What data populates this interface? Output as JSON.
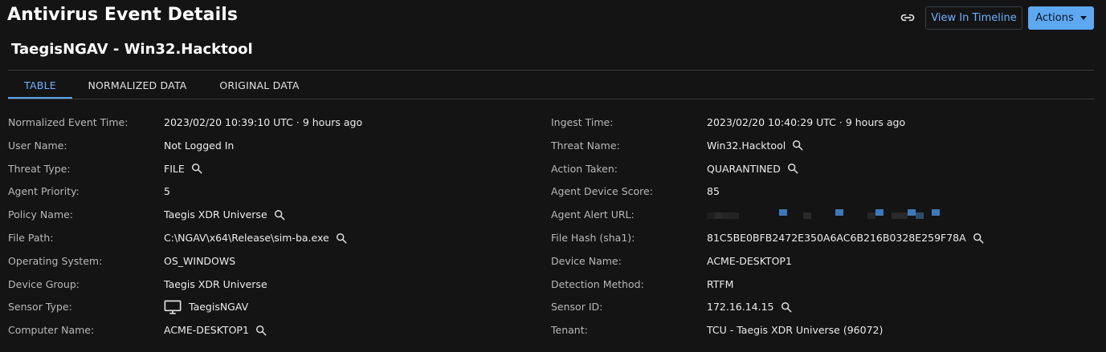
{
  "header": {
    "page_title": "Antivirus Event Details",
    "link_icon": "link-icon",
    "view_timeline_label": "View In Timeline",
    "actions_label": "Actions"
  },
  "event_title": "TaegisNGAV - Win32.Hacktool",
  "tabs": [
    {
      "label": "TABLE",
      "active": true
    },
    {
      "label": "NORMALIZED DATA",
      "active": false
    },
    {
      "label": "ORIGINAL DATA",
      "active": false
    }
  ],
  "colors": {
    "background": "#141414",
    "accent": "#5ea8f2",
    "link_text": "#6fb1ff",
    "label_text": "#b8b8b8",
    "value_text": "#ececec",
    "redacted_block": "#3d79b8"
  },
  "left_fields": [
    {
      "label": "Normalized Event Time:",
      "value": "2023/02/20 10:39:10 UTC · 9 hours ago",
      "search": false
    },
    {
      "label": "User Name:",
      "value": "Not Logged In",
      "search": false
    },
    {
      "label": "Threat Type:",
      "value": "FILE",
      "search": true
    },
    {
      "label": "Agent Priority:",
      "value": "5",
      "search": false
    },
    {
      "label": "Policy Name:",
      "value": "Taegis XDR Universe",
      "search": true
    },
    {
      "label": "File Path:",
      "value": "C:\\NGAV\\x64\\Release\\sim-ba.exe",
      "search": true
    },
    {
      "label": "Operating System:",
      "value": "OS_WINDOWS",
      "search": false
    },
    {
      "label": "Device Group:",
      "value": "Taegis XDR Universe",
      "search": false
    },
    {
      "label": "Sensor Type:",
      "value": "TaegisNGAV",
      "search": false,
      "icon": "monitor-icon"
    },
    {
      "label": "Computer Name:",
      "value": "ACME-DESKTOP1",
      "search": true
    }
  ],
  "right_fields": [
    {
      "label": "Ingest Time:",
      "value": "2023/02/20 10:40:29 UTC · 9 hours ago",
      "search": false
    },
    {
      "label": "Threat Name:",
      "value": "Win32.Hacktool",
      "search": true
    },
    {
      "label": "Action Taken:",
      "value": "QUARANTINED",
      "search": true
    },
    {
      "label": "Agent Device Score:",
      "value": "85",
      "search": false
    },
    {
      "label": "Agent Alert URL:",
      "value": "",
      "search": false,
      "redacted": true
    },
    {
      "label": "File Hash (sha1):",
      "value": "81C5BE0BFB2472E350A6AC6B216B0328E259F78A",
      "search": true
    },
    {
      "label": "Device Name:",
      "value": "ACME-DESKTOP1",
      "search": false
    },
    {
      "label": "Detection Method:",
      "value": "RTFM",
      "search": false
    },
    {
      "label": "Sensor ID:",
      "value": "172.16.14.15",
      "search": true
    },
    {
      "label": "Tenant:",
      "value": "TCU - Taegis XDR Universe (96072)",
      "search": false
    }
  ]
}
